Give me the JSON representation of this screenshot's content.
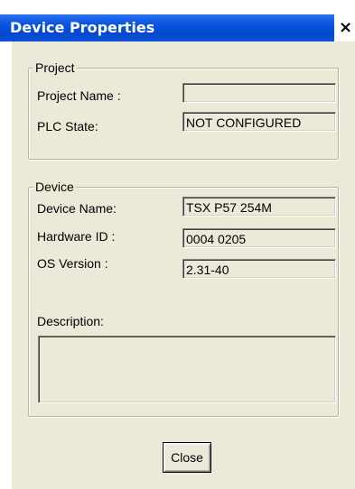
{
  "window": {
    "title": "Device Properties",
    "close_glyph": "×"
  },
  "project_group": {
    "legend": "Project",
    "project_name_label": "Project Name :",
    "project_name_value": "",
    "plc_state_label": "PLC State:",
    "plc_state_value": "NOT CONFIGURED"
  },
  "device_group": {
    "legend": "Device",
    "device_name_label": "Device Name:",
    "device_name_value": "TSX P57 254M",
    "hardware_id_label": "Hardware ID :",
    "hardware_id_value": "0004 0205",
    "os_version_label": "OS Version :",
    "os_version_value": "2.31-40",
    "description_label": "Description:",
    "description_value": ""
  },
  "buttons": {
    "close_label": "Close"
  },
  "colors": {
    "title_bar": "#0a55e0",
    "dialog_face": "#ece9d8"
  }
}
